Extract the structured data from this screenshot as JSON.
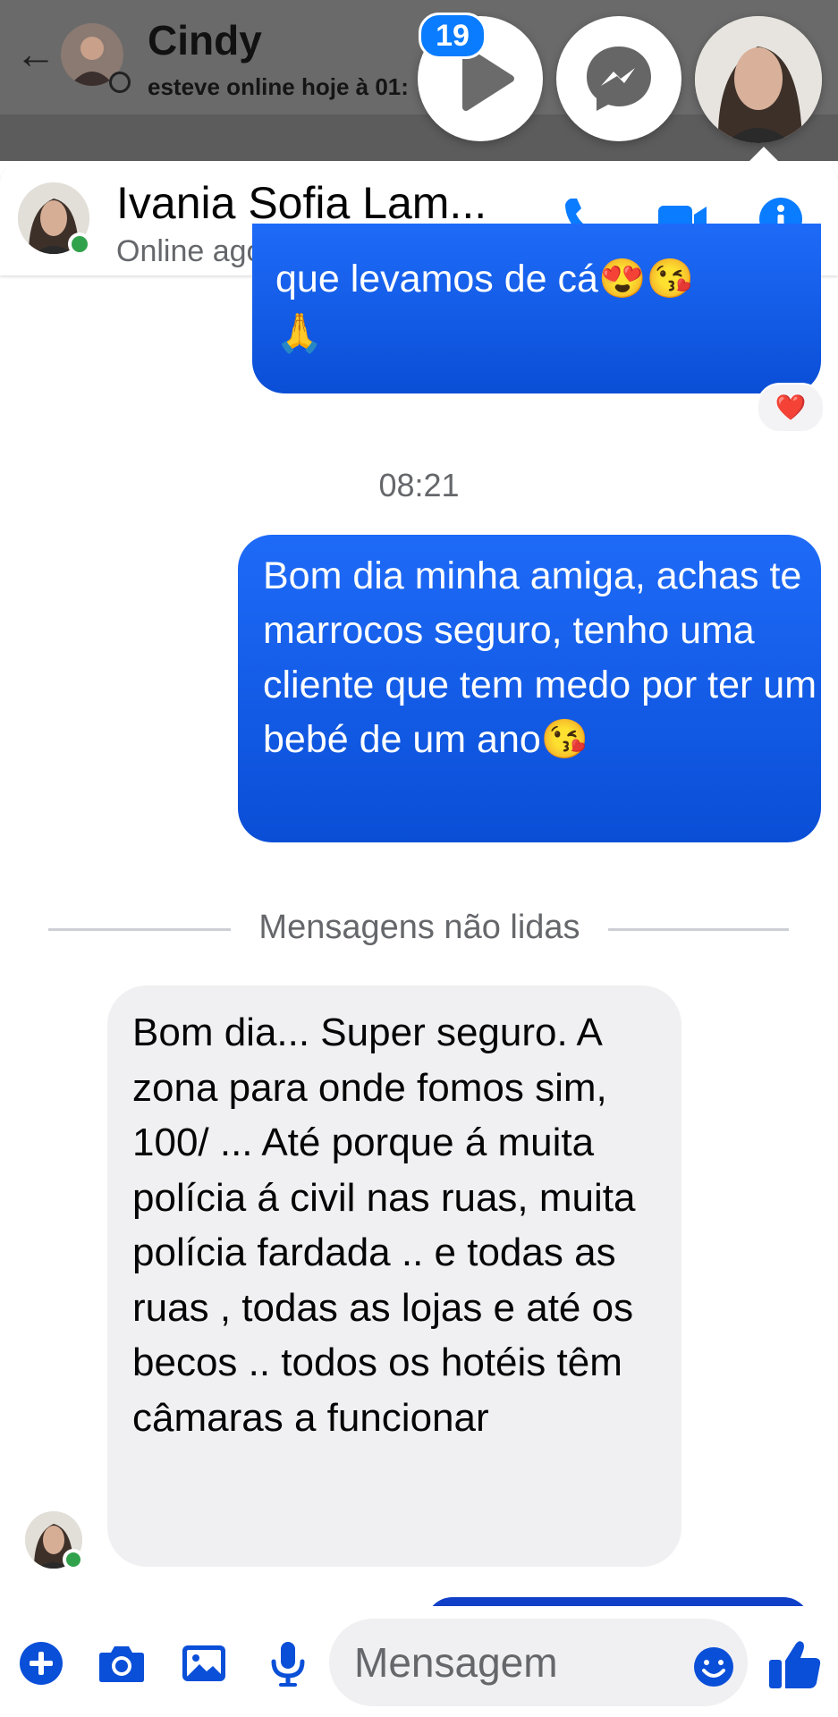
{
  "background_chat": {
    "contact_name": "Cindy",
    "status": "esteve online hoje à 01:"
  },
  "chat_heads": {
    "badge_count": "19"
  },
  "conversation": {
    "contact_name": "Ivania Sofia Lam...",
    "status": "Online agora"
  },
  "messages": [
    {
      "direction": "outgoing",
      "text": "que levamos de cá😍😘\n🙏",
      "reaction": "❤️"
    },
    {
      "type": "timestamp",
      "text": "08:21"
    },
    {
      "direction": "outgoing",
      "text": "Bom dia minha amiga, achas te marrocos seguro, tenho uma cliente que tem medo por ter um bebé de um ano😘"
    },
    {
      "type": "divider",
      "text": "Mensagens não lidas"
    },
    {
      "direction": "incoming",
      "text": "Bom dia... Super seguro. A zona para onde fomos sim, 100/ ... Até porque á muita polícia á civil nas ruas, muita polícia fardada .. e todas as ruas , todas as lojas e até os becos .. todos os hotéis têm câmaras a funcionar"
    }
  ],
  "composer": {
    "placeholder": "Mensagem"
  },
  "colors": {
    "accent": "#0a7cff",
    "outgoing_bubble": "#1560ee",
    "incoming_bubble": "#f0f0f2",
    "online": "#31a24c",
    "muted_text": "#65676b"
  },
  "icons": [
    "back-arrow-icon",
    "play-icon",
    "messenger-icon",
    "phone-icon",
    "video-camera-icon",
    "info-icon",
    "plus-icon",
    "camera-icon",
    "gallery-icon",
    "microphone-icon",
    "emoji-icon",
    "thumbs-up-icon",
    "heart-icon"
  ]
}
